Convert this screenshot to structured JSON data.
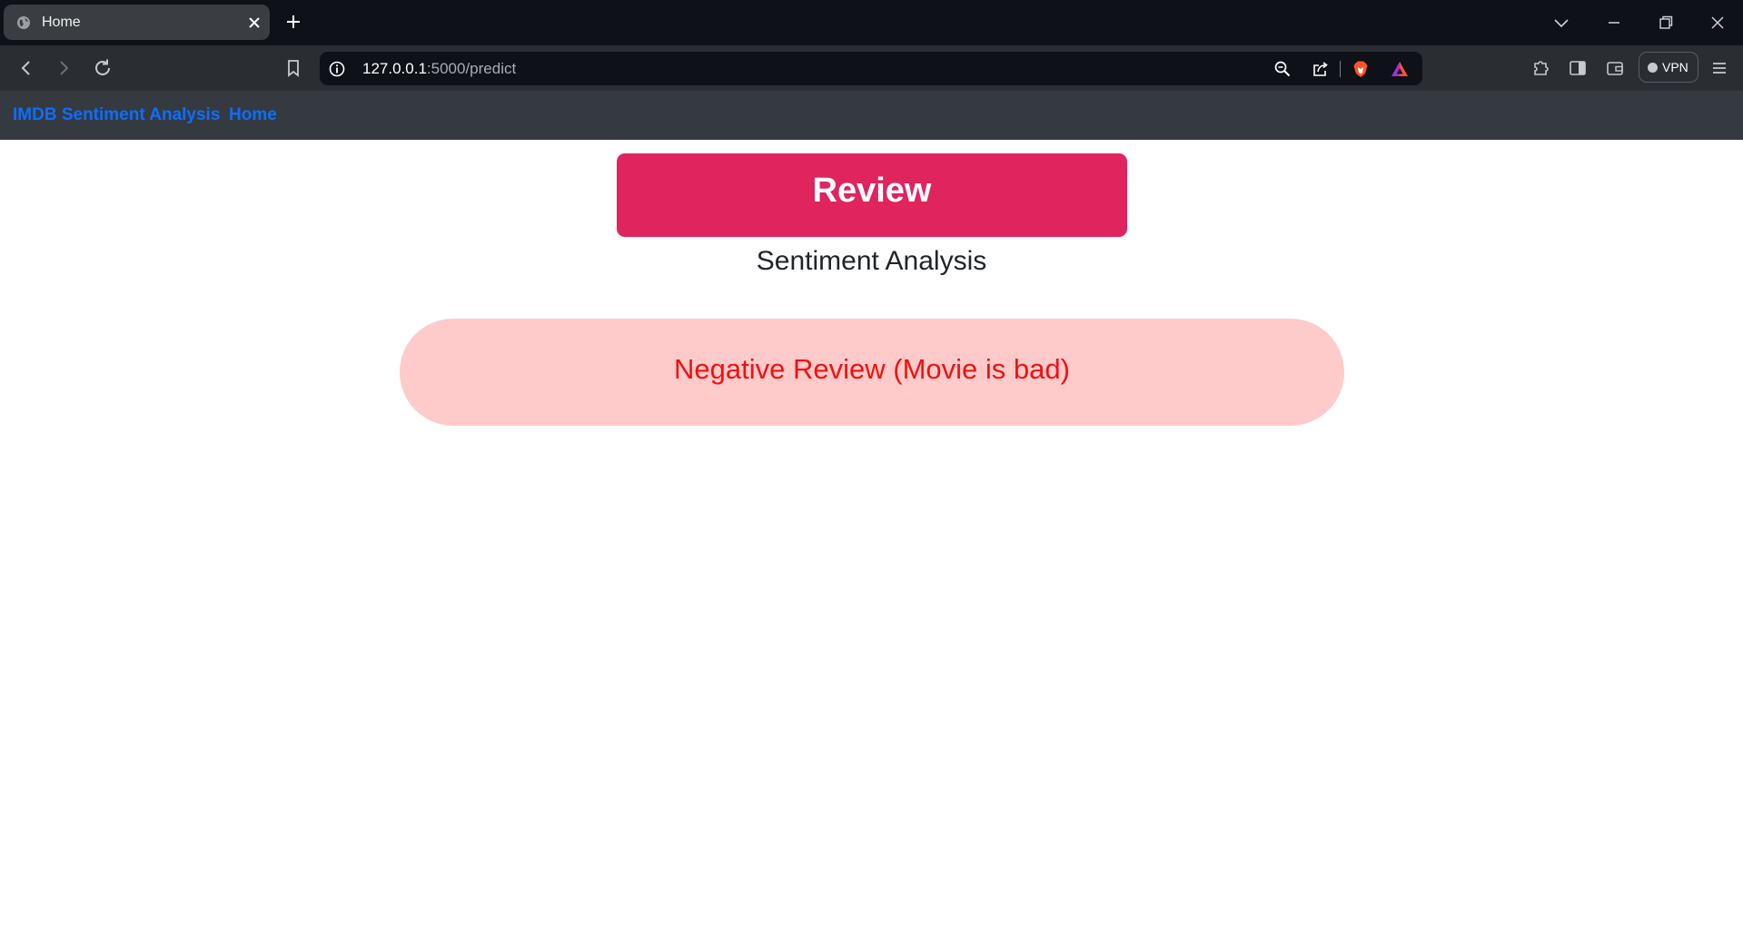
{
  "browser": {
    "tab": {
      "title": "Home"
    },
    "url": {
      "host": "127.0.0.1",
      "rest": ":5000/predict"
    },
    "vpn_label": "VPN",
    "icons": [
      "globe-icon",
      "close-icon",
      "plus-icon",
      "chevron-down-icon",
      "minimize-icon",
      "restore-icon",
      "window-close-icon",
      "back-icon",
      "forward-icon",
      "reload-icon",
      "bookmark-icon",
      "info-icon",
      "zoom-icon",
      "share-icon",
      "brave-shield-icon",
      "brave-rewards-icon",
      "extensions-icon",
      "sidebar-icon",
      "wallet-icon",
      "menu-icon"
    ]
  },
  "navbar": {
    "brand": "IMDB Sentiment Analysis",
    "home": "Home"
  },
  "main": {
    "review_heading": "Review",
    "subtitle": "Sentiment Analysis",
    "result_text": "Negative Review (Movie is bad)"
  },
  "colors": {
    "review_bg": "#e0245e",
    "result_bg": "#fecbca",
    "result_text": "#f50f0f",
    "nav_link": "#0d6efd",
    "navbar_bg": "#343a40"
  }
}
